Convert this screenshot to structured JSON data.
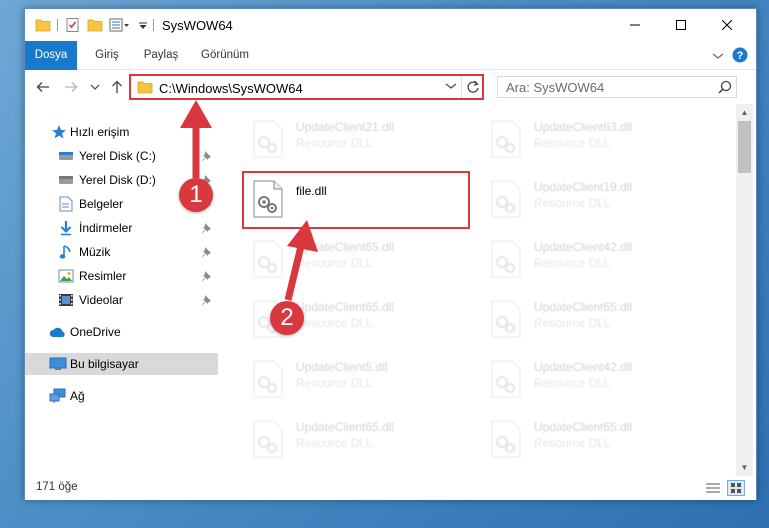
{
  "window": {
    "title": "SysWOW64"
  },
  "ribbon": {
    "tabs": [
      {
        "label": "Dosya"
      },
      {
        "label": "Giriş"
      },
      {
        "label": "Paylaş"
      },
      {
        "label": "Görünüm"
      }
    ]
  },
  "address": {
    "path": "C:\\Windows\\SysWOW64",
    "search_placeholder": "Ara: SysWOW64"
  },
  "nav": {
    "items": [
      {
        "label": "Hızlı erişim",
        "icon": "star-icon"
      },
      {
        "label": "Yerel Disk (C:)",
        "icon": "drive-icon",
        "pinned": true
      },
      {
        "label": "Yerel Disk (D:)",
        "icon": "drive-icon",
        "pinned": true
      },
      {
        "label": "Belgeler",
        "icon": "documents-icon",
        "pinned": true
      },
      {
        "label": "İndirmeler",
        "icon": "downloads-icon",
        "pinned": true
      },
      {
        "label": "Müzik",
        "icon": "music-icon",
        "pinned": true
      },
      {
        "label": "Resimler",
        "icon": "pictures-icon",
        "pinned": true
      },
      {
        "label": "Videolar",
        "icon": "videos-icon",
        "pinned": true
      },
      {
        "label": "OneDrive",
        "icon": "onedrive-icon"
      },
      {
        "label": "Bu bilgisayar",
        "icon": "computer-icon",
        "selected": true
      },
      {
        "label": "Ağ",
        "icon": "network-icon"
      }
    ]
  },
  "files": [
    {
      "name": "UpdateClient21.dll",
      "desc": "Resource DLL"
    },
    {
      "name": "UpdateClient63.dll",
      "desc": "Resource DLL"
    },
    {
      "name": "file.dll",
      "desc": ""
    },
    {
      "name": "UpdateClient19.dll",
      "desc": "Resource DLL"
    },
    {
      "name": "UpdateClient65.dll",
      "desc": "Resource DLL"
    },
    {
      "name": "UpdateClient42.dll",
      "desc": "Resource DLL"
    },
    {
      "name": "UpdateClient65.dll",
      "desc": "Resource DLL"
    },
    {
      "name": "UpdateClient65.dll",
      "desc": "Resource DLL"
    },
    {
      "name": "UpdateClient5.dll",
      "desc": "Resource DLL"
    },
    {
      "name": "UpdateClient42.dll",
      "desc": "Resource DLL"
    },
    {
      "name": "UpdateClient65.dll",
      "desc": "Resource DLL"
    },
    {
      "name": "UpdateClient65.dll",
      "desc": "Resource DLL"
    }
  ],
  "status": {
    "count": "171 öğe"
  },
  "annotations": {
    "step1": "1",
    "step2": "2"
  },
  "colors": {
    "accent": "#1979ca",
    "highlight": "#d9383f"
  }
}
